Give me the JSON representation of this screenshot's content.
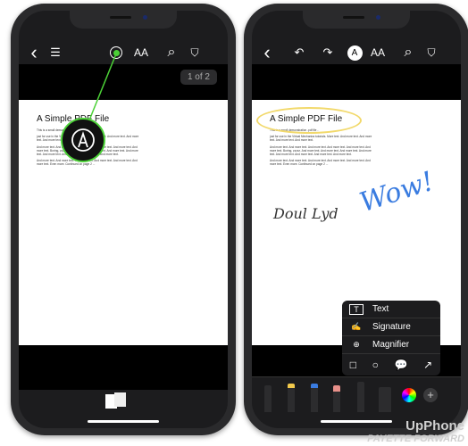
{
  "left": {
    "toolbar": {
      "back": "‹",
      "list": "☰",
      "markup": "◉",
      "text_size": "AA",
      "search": "⌕",
      "bookmark": "🔖"
    },
    "page_indicator": "1 of 2",
    "accent": "#4cd137"
  },
  "right": {
    "toolbar": {
      "back": "‹",
      "undo": "↶",
      "redo": "↷",
      "markup": "Ⓐ",
      "text_size": "AA",
      "search": "⌕",
      "bookmark": "🔖"
    },
    "menu": {
      "items": [
        {
          "icon": "text-box-icon",
          "glyph": "T",
          "label": "Text"
        },
        {
          "icon": "signature-icon",
          "glyph": "✍",
          "label": "Signature"
        },
        {
          "icon": "magnifier-icon",
          "glyph": "⊕",
          "label": "Magnifier"
        }
      ],
      "shapes": [
        "□",
        "○",
        "💬",
        "↗"
      ]
    },
    "handwriting": {
      "wow": "Wow!",
      "signature": "Doul Lyd"
    },
    "highlight_color": "#f2d96b",
    "ink_color": "#3a7ce0"
  },
  "pdf": {
    "title": "A Simple PDF File",
    "paragraphs": [
      "This is a small demonstration .pdf file -",
      "just for use in the Virtual Mechanics tutorials. More text. And more text. And more text. And more text. And more text.",
      "And more text. And more text. And more text. And more text. And more text. And more text. Boring, zzzzz. And more text. And more text. And more text. And more text. And more text. And more text. And more text. And more text.",
      "And more text. And more text. And more text. And more text. And more text. And more text. Even more. Continued on page 2 ..."
    ]
  },
  "watermark": {
    "line1": "UpPhone",
    "line2": "PAYETTE FORWARD"
  }
}
